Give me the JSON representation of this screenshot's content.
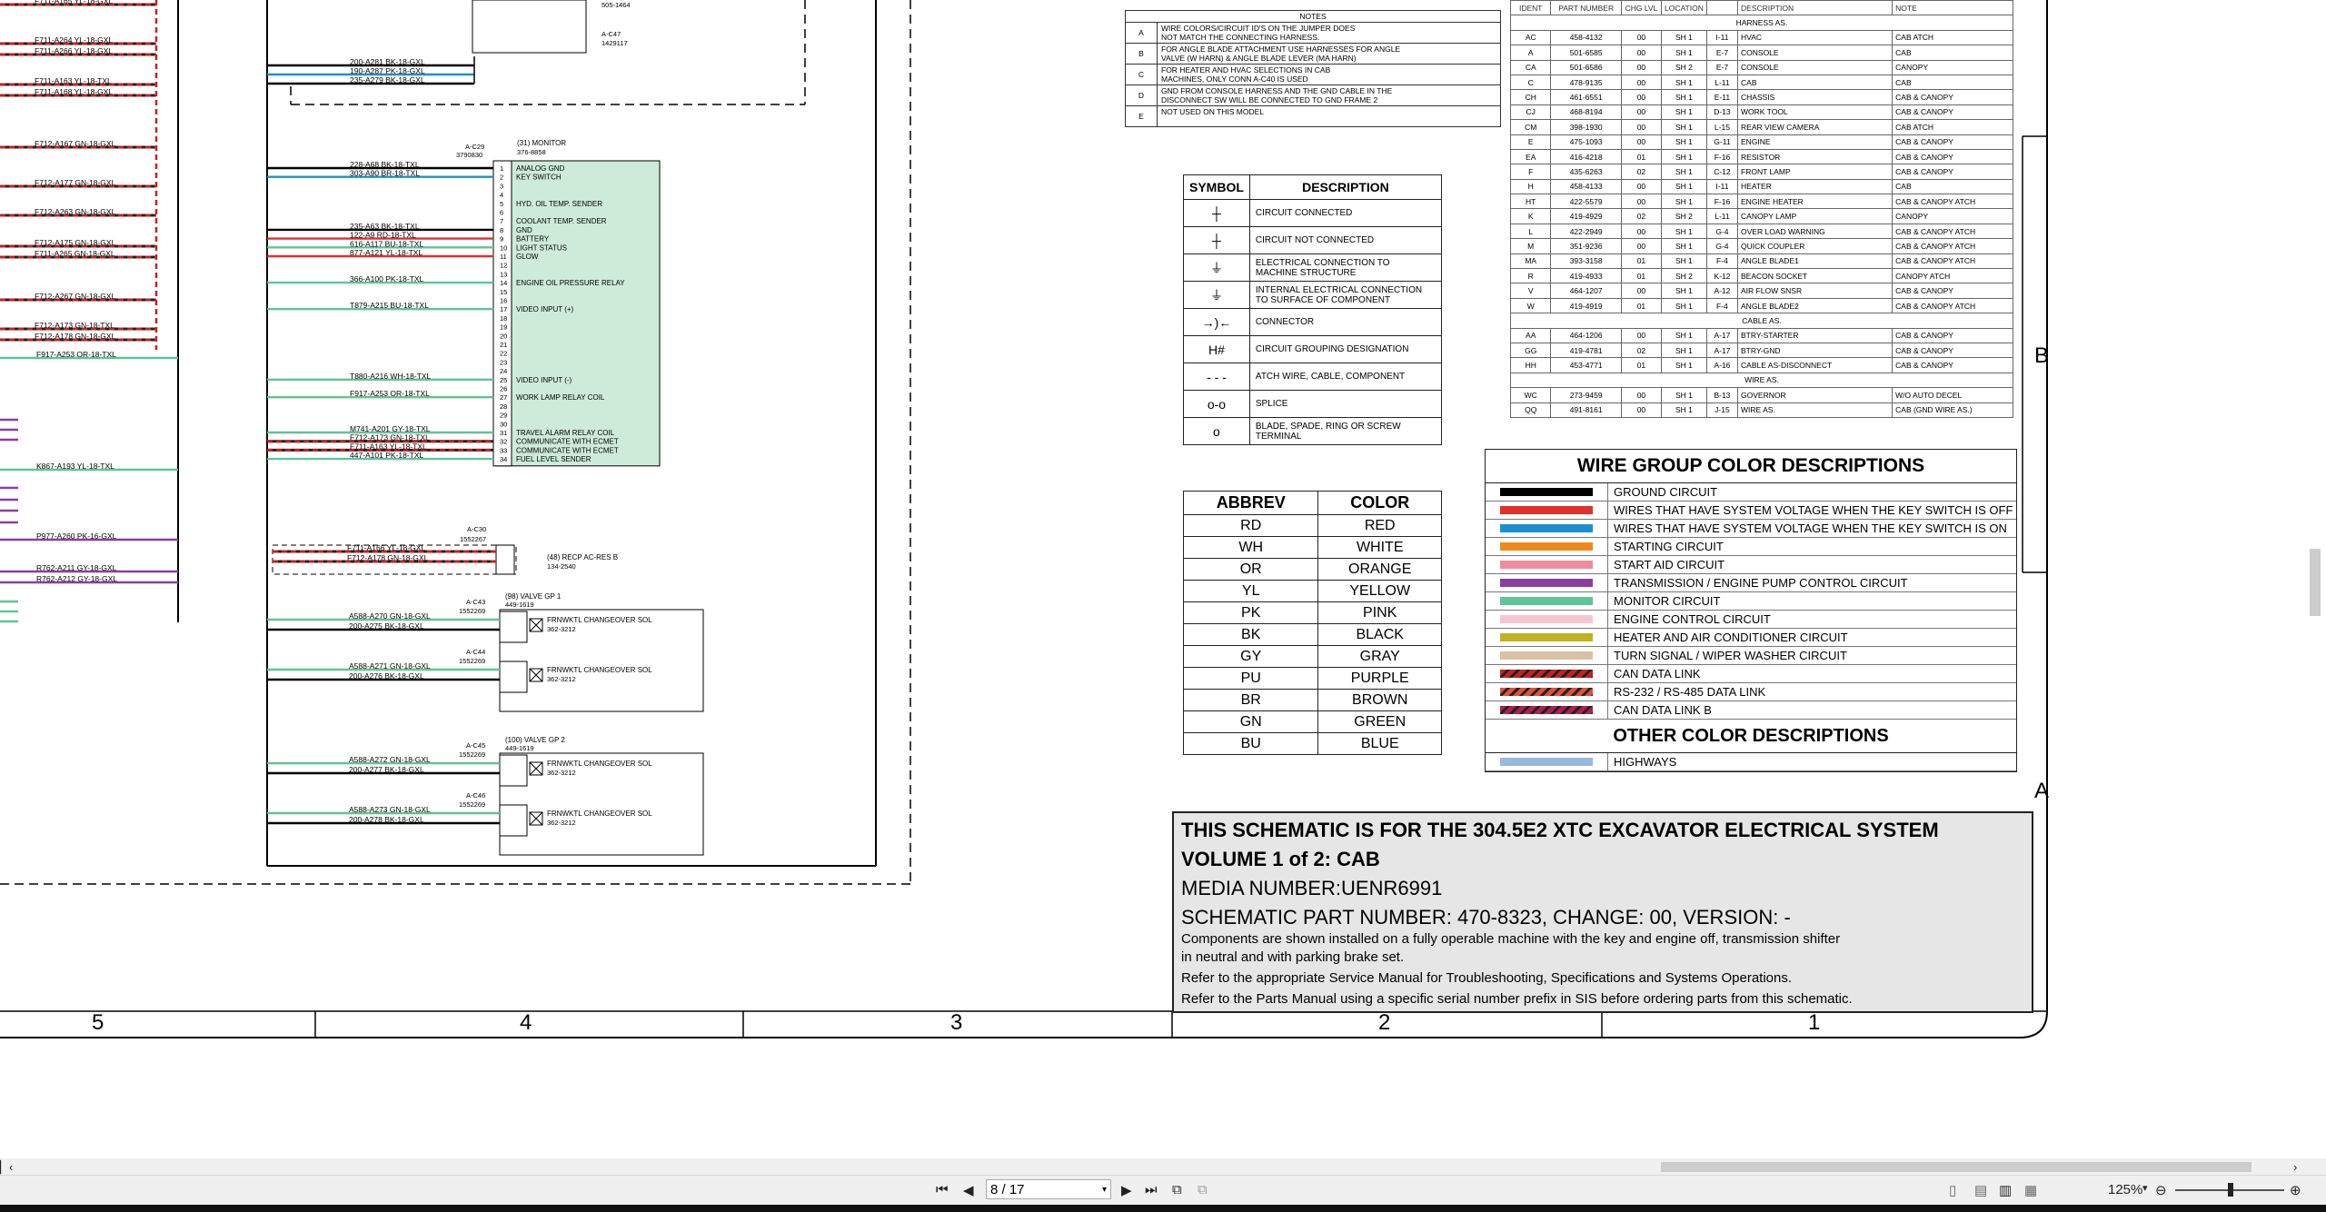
{
  "notes": {
    "title": "NOTES",
    "rows": [
      {
        "key": "A",
        "text": "WIRE COLORS/CIRCUIT ID'S ON THE JUMPER DOES\nNOT MATCH THE CONNECTING HARNESS."
      },
      {
        "key": "B",
        "text": "FOR ANGLE BLADE ATTACHMENT USE HARNESSES FOR ANGLE\nVALVE (W HARN) & ANGLE BLADE LEVER (MA HARN)"
      },
      {
        "key": "C",
        "text": "FOR HEATER AND HVAC SELECTIONS IN CAB\nMACHINES, ONLY CONN A-C40 IS USED"
      },
      {
        "key": "D",
        "text": "GND FROM CONSOLE HARNESS AND THE GND CABLE IN THE\nDISCONNECT SW WILL BE CONNECTED TO GND FRAME 2"
      },
      {
        "key": "E",
        "text": "NOT USED ON THIS MODEL"
      }
    ]
  },
  "symbols": {
    "header_symbol": "SYMBOL",
    "header_desc": "DESCRIPTION",
    "rows": [
      {
        "sym": "┼",
        "desc": "CIRCUIT CONNECTED"
      },
      {
        "sym": "┼",
        "desc": "CIRCUIT NOT CONNECTED"
      },
      {
        "sym": "⏚",
        "desc": "ELECTRICAL CONNECTION TO\nMACHINE STRUCTURE"
      },
      {
        "sym": "⏚",
        "desc": "INTERNAL ELECTRICAL CONNECTION\nTO SURFACE OF COMPONENT"
      },
      {
        "sym": "→)←",
        "desc": "CONNECTOR"
      },
      {
        "sym": "H#",
        "desc": "CIRCUIT GROUPING DESIGNATION"
      },
      {
        "sym": "- - -",
        "desc": "ATCH WIRE, CABLE, COMPONENT"
      },
      {
        "sym": "o-o",
        "desc": "SPLICE"
      },
      {
        "sym": "o",
        "desc": "BLADE, SPADE, RING OR SCREW\nTERMINAL"
      }
    ]
  },
  "abbrev": {
    "header_abbrev": "ABBREV",
    "header_color": "COLOR",
    "rows": [
      {
        "a": "RD",
        "c": "RED"
      },
      {
        "a": "WH",
        "c": "WHITE"
      },
      {
        "a": "OR",
        "c": "ORANGE"
      },
      {
        "a": "YL",
        "c": "YELLOW"
      },
      {
        "a": "PK",
        "c": "PINK"
      },
      {
        "a": "BK",
        "c": "BLACK"
      },
      {
        "a": "GY",
        "c": "GRAY"
      },
      {
        "a": "PU",
        "c": "PURPLE"
      },
      {
        "a": "BR",
        "c": "BROWN"
      },
      {
        "a": "GN",
        "c": "GREEN"
      },
      {
        "a": "BU",
        "c": "BLUE"
      }
    ]
  },
  "parts": {
    "header": [
      "IDENT",
      "PART NUMBER",
      "CHG LVL",
      "LOCATION",
      "",
      "DESCRIPTION",
      "NOTE"
    ],
    "group_harness": "HARNESS AS.",
    "group_cable": "CABLE AS.",
    "group_wire": "WIRE AS.",
    "harness_rows": [
      [
        "AC",
        "458-4132",
        "00",
        "SH 1",
        "I-11",
        "HVAC",
        "CAB ATCH"
      ],
      [
        "A",
        "501-6585",
        "00",
        "SH 1",
        "E-7",
        "CONSOLE",
        "CAB"
      ],
      [
        "CA",
        "501-6586",
        "00",
        "SH 2",
        "E-7",
        "CONSOLE",
        "CANOPY"
      ],
      [
        "C",
        "478-9135",
        "00",
        "SH 1",
        "L-11",
        "CAB",
        "CAB"
      ],
      [
        "CH",
        "461-6551",
        "00",
        "SH 1",
        "E-11",
        "CHASSIS",
        "CAB & CANOPY"
      ],
      [
        "CJ",
        "468-8194",
        "00",
        "SH 1",
        "D-13",
        "WORK TOOL",
        "CAB & CANOPY"
      ],
      [
        "CM",
        "398-1930",
        "00",
        "SH 1",
        "L-15",
        "REAR VIEW CAMERA",
        "CAB ATCH"
      ],
      [
        "E",
        "475-1093",
        "00",
        "SH 1",
        "G-11",
        "ENGINE",
        "CAB & CANOPY"
      ],
      [
        "EA",
        "416-4218",
        "01",
        "SH 1",
        "F-16",
        "RESISTOR",
        "CAB & CANOPY"
      ],
      [
        "F",
        "435-6263",
        "02",
        "SH 1",
        "C-12",
        "FRONT LAMP",
        "CAB & CANOPY"
      ],
      [
        "H",
        "458-4133",
        "00",
        "SH 1",
        "I-11",
        "HEATER",
        "CAB"
      ],
      [
        "HT",
        "422-5579",
        "00",
        "SH 1",
        "F-16",
        "ENGINE HEATER",
        "CAB & CANOPY ATCH"
      ],
      [
        "K",
        "419-4929",
        "02",
        "SH 2",
        "L-11",
        "CANOPY LAMP",
        "CANOPY"
      ],
      [
        "L",
        "422-2949",
        "00",
        "SH 1",
        "G-4",
        "OVER LOAD WARNING",
        "CAB & CANOPY ATCH"
      ],
      [
        "M",
        "351-9236",
        "00",
        "SH 1",
        "G-4",
        "QUICK COUPLER",
        "CAB & CANOPY ATCH"
      ],
      [
        "MA",
        "393-3158",
        "01",
        "SH 1",
        "F-4",
        "ANGLE BLADE1",
        "CAB & CANOPY ATCH"
      ],
      [
        "R",
        "419-4933",
        "01",
        "SH 2",
        "K-12",
        "BEACON SOCKET",
        "CANOPY ATCH"
      ],
      [
        "V",
        "464-1207",
        "00",
        "SH 1",
        "A-12",
        "AIR FLOW SNSR",
        "CAB & CANOPY"
      ],
      [
        "W",
        "419-4919",
        "01",
        "SH 1",
        "F-4",
        "ANGLE BLADE2",
        "CAB & CANOPY ATCH"
      ]
    ],
    "cable_rows": [
      [
        "AA",
        "464-1206",
        "00",
        "SH 1",
        "A-17",
        "BTRY-STARTER",
        "CAB & CANOPY"
      ],
      [
        "GG",
        "419-4781",
        "02",
        "SH 1",
        "A-17",
        "BTRY-GND",
        "CAB & CANOPY"
      ],
      [
        "HH",
        "453-4771",
        "01",
        "SH 1",
        "A-16",
        "CABLE AS-DISCONNECT",
        "CAB & CANOPY"
      ]
    ],
    "wire_rows": [
      [
        "WC",
        "273-9459",
        "00",
        "SH 1",
        "B-13",
        "GOVERNOR",
        "W/O AUTO DECEL"
      ],
      [
        "QQ",
        "491-8161",
        "00",
        "SH 1",
        "J-15",
        "WIRE AS.",
        "CAB (GND WIRE AS.)"
      ]
    ]
  },
  "wire_group": {
    "title": "WIRE GROUP COLOR DESCRIPTIONS",
    "rows": [
      {
        "color": "#000000",
        "pattern": "solid",
        "label": "GROUND CIRCUIT"
      },
      {
        "color": "#e0312c",
        "pattern": "solid",
        "label": "WIRES THAT HAVE SYSTEM VOLTAGE WHEN THE KEY SWITCH IS OFF"
      },
      {
        "color": "#1c8fd0",
        "pattern": "solid",
        "label": "WIRES THAT HAVE SYSTEM VOLTAGE WHEN THE KEY SWITCH IS ON"
      },
      {
        "color": "#f0891c",
        "pattern": "solid",
        "label": "STARTING CIRCUIT"
      },
      {
        "color": "#f08ca0",
        "pattern": "solid",
        "label": "START AID CIRCUIT"
      },
      {
        "color": "#8a3fa0",
        "pattern": "solid",
        "label": "TRANSMISSION / ENGINE PUMP CONTROL CIRCUIT"
      },
      {
        "color": "#5ec49a",
        "pattern": "solid",
        "label": "MONITOR CIRCUIT"
      },
      {
        "color": "#f6c6d2",
        "pattern": "solid",
        "label": "ENGINE CONTROL CIRCUIT"
      },
      {
        "color": "#c2b020",
        "pattern": "solid",
        "label": "HEATER AND AIR CONDITIONER CIRCUIT"
      },
      {
        "color": "#dcc0a4",
        "pattern": "solid",
        "label": "TURN SIGNAL / WIPER WASHER CIRCUIT"
      },
      {
        "color": "#c82020",
        "pattern": "stripe",
        "label": "CAN DATA LINK"
      },
      {
        "color": "#e0503a",
        "pattern": "stripe",
        "label": "RS-232 / RS-485 DATA LINK"
      },
      {
        "color": "#b02050",
        "pattern": "stripe",
        "label": "CAN DATA LINK B"
      }
    ],
    "other_title": "OTHER COLOR DESCRIPTIONS",
    "other_rows": [
      {
        "color": "#9ab8dc",
        "pattern": "solid",
        "label": "HIGHWAYS"
      }
    ]
  },
  "title_block": {
    "line1": "THIS SCHEMATIC IS FOR THE 304.5E2 XTC EXCAVATOR ELECTRICAL SYSTEM",
    "line2": "VOLUME 1 of 2: CAB",
    "line3": "MEDIA NUMBER:UENR6991",
    "line4": "SCHEMATIC PART NUMBER: 470-8323, CHANGE: 00, VERSION: -",
    "para1": "Components are shown installed on a fully operable machine with the key and engine off, transmission shifter",
    "para2": "in neutral and with parking brake set.",
    "para3": "Refer to the appropriate Service Manual for Troubleshooting, Specifications and Systems Operations.",
    "para4": "Refer to the Parts Manual using a specific serial number prefix in SIS before ordering parts from this schematic."
  },
  "grid": {
    "columns": [
      "5",
      "4",
      "3",
      "2",
      "1"
    ],
    "rows": [
      "B",
      "A"
    ]
  },
  "schematic": {
    "monitor_label": "(31) MONITOR",
    "monitor_part": "376-8858",
    "monitor_conn": "A-C29",
    "monitor_conn_part": "3790830",
    "monitor_pins": [
      {
        "n": "1",
        "name": "ANALOG GND"
      },
      {
        "n": "2",
        "name": "KEY SWITCH"
      },
      {
        "n": "3",
        "name": ""
      },
      {
        "n": "4",
        "name": ""
      },
      {
        "n": "5",
        "name": "HYD. OIL TEMP. SENDER"
      },
      {
        "n": "6",
        "name": ""
      },
      {
        "n": "7",
        "name": "COOLANT TEMP. SENDER"
      },
      {
        "n": "8",
        "name": "GND"
      },
      {
        "n": "9",
        "name": "BATTERY"
      },
      {
        "n": "10",
        "name": "LIGHT STATUS"
      },
      {
        "n": "11",
        "name": "GLOW"
      },
      {
        "n": "12",
        "name": ""
      },
      {
        "n": "13",
        "name": ""
      },
      {
        "n": "14",
        "name": "ENGINE OIL PRESSURE RELAY"
      },
      {
        "n": "15",
        "name": ""
      },
      {
        "n": "16",
        "name": ""
      },
      {
        "n": "17",
        "name": "VIDEO INPUT (+)"
      },
      {
        "n": "18",
        "name": ""
      },
      {
        "n": "19",
        "name": ""
      },
      {
        "n": "20",
        "name": ""
      },
      {
        "n": "21",
        "name": ""
      },
      {
        "n": "22",
        "name": ""
      },
      {
        "n": "23",
        "name": ""
      },
      {
        "n": "24",
        "name": ""
      },
      {
        "n": "25",
        "name": "VIDEO INPUT (-)"
      },
      {
        "n": "26",
        "name": ""
      },
      {
        "n": "27",
        "name": "WORK LAMP RELAY COIL"
      },
      {
        "n": "28",
        "name": ""
      },
      {
        "n": "29",
        "name": ""
      },
      {
        "n": "30",
        "name": ""
      },
      {
        "n": "31",
        "name": "TRAVEL ALARM RELAY COIL"
      },
      {
        "n": "32",
        "name": "COMMUNICATE WITH ECMET"
      },
      {
        "n": "33",
        "name": "COMMUNICATE WITH ECMET"
      },
      {
        "n": "34",
        "name": "FUEL LEVEL SENDER"
      }
    ],
    "wires_top": [
      {
        "label": "200-A281 BK-18-GXL",
        "color": "#000"
      },
      {
        "label": "190-A287 PK-18-GXL",
        "color": "#1c8fd0"
      },
      {
        "label": "235-A279 BK-18-GXL",
        "color": "#000"
      }
    ],
    "conn_top": "A-C47",
    "conn_top_part": "1429117",
    "part_top": "505-1464",
    "monitor_wires": [
      {
        "label": "228-A68 BK-18-TXL",
        "color": "#000",
        "pin": 1
      },
      {
        "label": "303-A90 BR-18-TXL",
        "color": "#1c8fd0",
        "pin": 2
      },
      {
        "label": "235-A63 BK-18-TXL",
        "color": "#000",
        "pin": 8
      },
      {
        "label": "122-A9 RD-18-TXL",
        "color": "#e0312c",
        "pin": 9
      },
      {
        "label": "616-A117 BU-18-TXL",
        "color": "#5ec49a",
        "pin": 10
      },
      {
        "label": "877-A121 YL-18-TXL",
        "color": "#e0312c",
        "pin": 11
      },
      {
        "label": "366-A100 PK-18-TXL",
        "color": "#5ec49a",
        "pin": 14
      },
      {
        "label": "T879-A215 BU-18-TXL",
        "color": "#5ec49a",
        "pin": 17
      },
      {
        "label": "T880-A216 WH-18-TXL",
        "color": "#5ec49a",
        "pin": 25
      },
      {
        "label": "F917-A253 OR-18-TXL",
        "color": "#5ec49a",
        "pin": 27
      },
      {
        "label": "M741-A201 GY-18-TXL",
        "color": "#5ec49a",
        "pin": 31
      },
      {
        "label": "F712-A173 GN-18-TXL",
        "color": "#c82020",
        "pin": 32
      },
      {
        "label": "F711-A163 YL-18-TXL",
        "color": "#c82020",
        "pin": 33
      },
      {
        "label": "447-A101 PK-18-TXL",
        "color": "#5ec49a",
        "pin": 34
      }
    ],
    "left_wires": [
      {
        "label": "F711-A165 YL-18-GXL",
        "color": "#c82020"
      },
      {
        "label": "F711-A264 YL-18-GXL",
        "color": "#c82020"
      },
      {
        "label": "F711-A266 YL-18-GXL",
        "color": "#c82020"
      },
      {
        "label": "F711-A163 YL-18-TXL",
        "color": "#c82020"
      },
      {
        "label": "F711-A168 YL-18-GXL",
        "color": "#c82020"
      },
      {
        "label": "F712-A167 GN-18-GXL",
        "color": "#c82020"
      },
      {
        "label": "F712-A177 GN-18-GXL",
        "color": "#c82020"
      },
      {
        "label": "F712-A263 GN-18-GXL",
        "color": "#c82020"
      },
      {
        "label": "F712-A175 GN-18-GXL",
        "color": "#c82020"
      },
      {
        "label": "F711-A265 GN-18-GXL",
        "color": "#c82020"
      },
      {
        "label": "F712-A267 GN-18-GXL",
        "color": "#c82020"
      },
      {
        "label": "F712-A173 GN-18-TXL",
        "color": "#c82020"
      },
      {
        "label": "F712-A178 GN-18-GXL",
        "color": "#c82020"
      },
      {
        "label": "F917-A253 OR-18-TXL",
        "color": "#5ec49a"
      },
      {
        "label": "K867-A193 YL-18-TXL",
        "color": "#5ec49a"
      },
      {
        "label": "P977-A260 PK-16-GXL",
        "color": "#8a3fa0"
      },
      {
        "label": "R762-A211 GY-18-GXL",
        "color": "#8a3fa0"
      },
      {
        "label": "R762-A212 GY-18-GXL",
        "color": "#8a3fa0"
      }
    ],
    "recep": {
      "label": "(48) RECP AC-RES B",
      "part": "134-2540",
      "conn": "A-C30",
      "conn_part": "1552267",
      "wires": [
        "F711-A166 YL-18-GXL",
        "F712-A178 GN-18-GXL"
      ]
    },
    "valve1": {
      "label": "(98) VALVE GP 1",
      "part": "449-1619",
      "sols": [
        {
          "conn": "A-C43",
          "conn_part": "1552269",
          "w1": "A588-A270 GN-18-GXL",
          "w2": "200-A275 BK-18-GXL",
          "name": "FRNWKTL CHANGEOVER SOL",
          "pn": "362-3212"
        },
        {
          "conn": "A-C44",
          "conn_part": "1552269",
          "w1": "A588-A271 GN-18-GXL",
          "w2": "200-A276 BK-18-GXL",
          "name": "FRNWKTL CHANGEOVER SOL",
          "pn": "362-3212"
        }
      ]
    },
    "valve2": {
      "label": "(100) VALVE GP 2",
      "part": "449-1619",
      "sols": [
        {
          "conn": "A-C45",
          "conn_part": "1552269",
          "w1": "A588-A272 GN-18-GXL",
          "w2": "200-A277 BK-18-GXL",
          "name": "FRNWKTL CHANGEOVER SOL",
          "pn": "362-3212"
        },
        {
          "conn": "A-C46",
          "conn_part": "1552269",
          "w1": "A588-A273 GN-18-GXL",
          "w2": "200-A278 BK-18-GXL",
          "name": "FRNWKTL CHANGEOVER SOL",
          "pn": "362-3212"
        }
      ]
    }
  },
  "viewer": {
    "page_value": "8 / 17",
    "zoom_value": "125%",
    "first_page_icon": "first-page-icon",
    "prev_page_icon": "prev-page-icon",
    "next_page_icon": "next-page-icon",
    "last_page_icon": "last-page-icon"
  }
}
